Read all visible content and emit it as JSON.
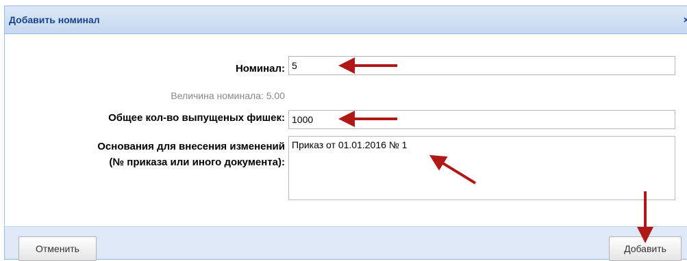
{
  "dialog": {
    "title": "Добавить номинал",
    "close_glyph": "×"
  },
  "form": {
    "nominal_label": "Номинал:",
    "nominal_value": "5",
    "nominal_amount_label": "Величина номинала: 5.00",
    "chips_label": "Общее кол-во выпущеных фишек:",
    "chips_value": "1000",
    "reason_label_line1": "Основания для внесения изменений",
    "reason_label_line2": "(№ приказа или иного документа):",
    "reason_value": "Приказ от 01.01.2016 № 1"
  },
  "footer": {
    "cancel_label": "Отменить",
    "add_label": "Добавить"
  },
  "colors": {
    "annotation_arrow": "#b01818",
    "title_text": "#15428b",
    "title_bg": "#c6d9f1"
  }
}
